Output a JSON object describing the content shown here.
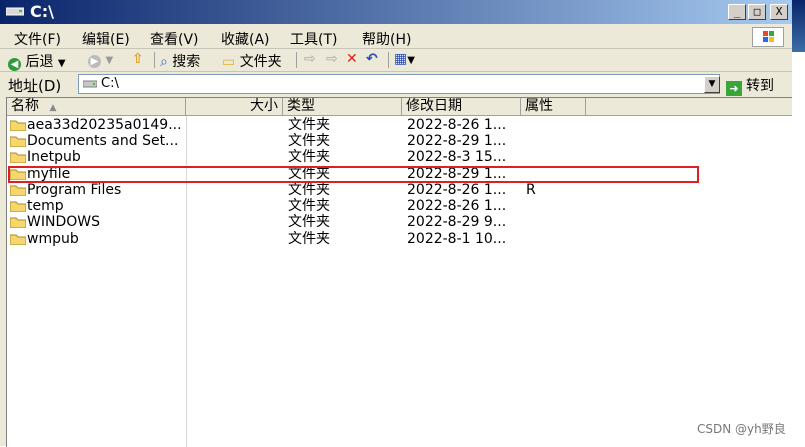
{
  "window": {
    "title": "C:\\"
  },
  "title_buttons": {
    "minimize": "_",
    "maximize": "□",
    "close": "X"
  },
  "menubar": [
    "文件(F)",
    "编辑(E)",
    "查看(V)",
    "收藏(A)",
    "工具(T)",
    "帮助(H)"
  ],
  "toolbar": {
    "back": "后退",
    "search": "搜索",
    "folders": "文件夹"
  },
  "address": {
    "label": "地址(D)",
    "value": "C:\\",
    "go": "转到"
  },
  "columns": {
    "name": "名称",
    "size": "大小",
    "type": "类型",
    "modified": "修改日期",
    "attributes": "属性"
  },
  "files": [
    {
      "name": "aea33d20235a0149...",
      "type": "文件夹",
      "modified": "2022-8-26 1...",
      "attr": ""
    },
    {
      "name": "Documents and Set...",
      "type": "文件夹",
      "modified": "2022-8-29 1...",
      "attr": ""
    },
    {
      "name": "Inetpub",
      "type": "文件夹",
      "modified": "2022-8-3 15...",
      "attr": ""
    },
    {
      "name": "myfile",
      "type": "文件夹",
      "modified": "2022-8-29 1...",
      "attr": ""
    },
    {
      "name": "Program Files",
      "type": "文件夹",
      "modified": "2022-8-26 1...",
      "attr": "R"
    },
    {
      "name": "temp",
      "type": "文件夹",
      "modified": "2022-8-26 1...",
      "attr": ""
    },
    {
      "name": "WINDOWS",
      "type": "文件夹",
      "modified": "2022-8-29 9...",
      "attr": ""
    },
    {
      "name": "wmpub",
      "type": "文件夹",
      "modified": "2022-8-1 10...",
      "attr": ""
    }
  ],
  "watermark": "CSDN @yh野良",
  "colors": {
    "title_start": "#0a246a",
    "title_end": "#a6caf0",
    "highlight_border": "#e02020",
    "folder": "#f5d76e"
  }
}
